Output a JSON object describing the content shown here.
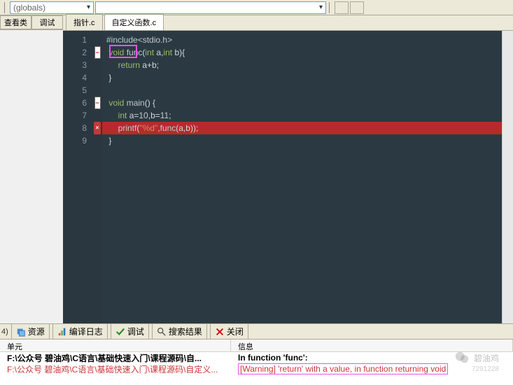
{
  "toolbar": {
    "scope": "(globals)"
  },
  "left_tabs": [
    "查看类",
    "调试"
  ],
  "file_tabs": [
    {
      "label": "指针.c",
      "active": false
    },
    {
      "label": "自定义函数.c",
      "active": true
    }
  ],
  "code_lines": [
    {
      "n": 1,
      "html": "<span class='inc'>#include&lt;stdio.h&gt;</span>"
    },
    {
      "n": 2,
      "fold": "-",
      "html": " <span class='kw'>void</span> <span class='fn'>func</span>(<span class='kw'>int</span> a,<span class='kw'>int</span> b){"
    },
    {
      "n": 3,
      "html": "     <span class='kw'>return</span> a+b;"
    },
    {
      "n": 4,
      "html": " }"
    },
    {
      "n": 5,
      "html": ""
    },
    {
      "n": 6,
      "fold": "-",
      "html": " <span class='kw'>void</span> <span class='fn'>main</span>() {"
    },
    {
      "n": 7,
      "html": "     <span class='kw'>int</span> a=<span class='numc'>10</span>,b=<span class='numc'>11</span>;"
    },
    {
      "n": 8,
      "err": true,
      "highlight": true,
      "html": "     <span class='fn'>printf</span>(<span class='str'>\"%d\"</span>,<span class='fn'>func</span>(a,b));"
    },
    {
      "n": 9,
      "html": " }"
    }
  ],
  "highlight_keyword_box": {
    "top_line": 2
  },
  "bottom": {
    "count": "4)",
    "tabs": [
      {
        "name": "resources",
        "label": "资源",
        "icon": "layers"
      },
      {
        "name": "compilelog",
        "label": "编译日志",
        "icon": "bars"
      },
      {
        "name": "debug",
        "label": "调试",
        "icon": "check"
      },
      {
        "name": "search",
        "label": "搜索结果",
        "icon": "search"
      },
      {
        "name": "close",
        "label": "关闭",
        "icon": "x"
      }
    ],
    "headers": {
      "unit": "单元",
      "info": "信息"
    },
    "rows": [
      {
        "unit": "F:\\公众号 碧油鸡\\C语言\\基础快速入门\\课程源码\\自...",
        "info": "In function 'func':",
        "bold_info": true
      },
      {
        "unit": "F:\\公众号 碧油鸡\\C语言\\基础快速入门\\课程源码\\自定义...",
        "info": "[Warning] 'return' with a value, in function returning void",
        "warn": true,
        "boxed": true
      }
    ]
  },
  "watermark": {
    "text": "碧油鸡",
    "sub": "7291228"
  }
}
